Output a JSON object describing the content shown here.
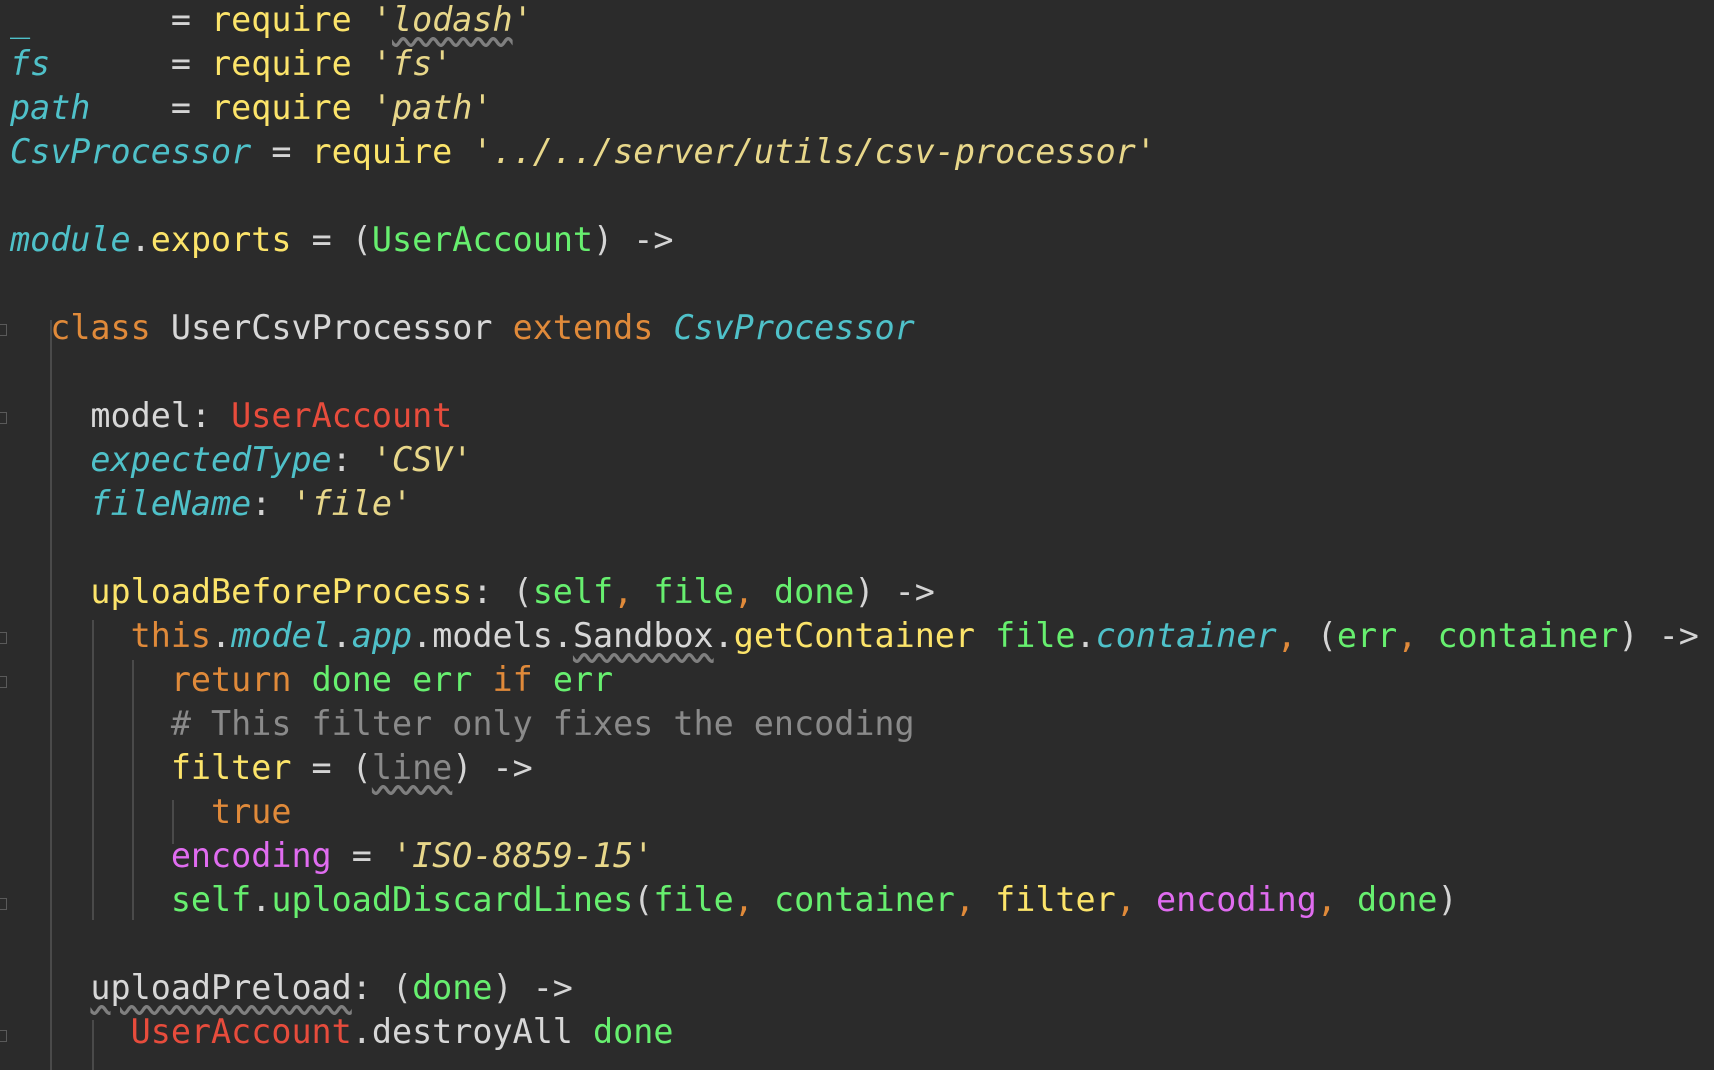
{
  "code_lines": [
    {
      "tokens": [
        [
          "_",
          "id"
        ],
        [
          "       = ",
          "op"
        ],
        [
          "require",
          "fn"
        ],
        [
          " ",
          "op"
        ],
        [
          "'",
          "str"
        ],
        [
          "lodash",
          "str"
        ],
        [
          "'",
          "str"
        ]
      ]
    },
    {
      "tokens": [
        [
          "fs",
          "id"
        ],
        [
          "      = ",
          "op"
        ],
        [
          "require",
          "fn"
        ],
        [
          " ",
          "op"
        ],
        [
          "'fs'",
          "str"
        ]
      ]
    },
    {
      "tokens": [
        [
          "path",
          "id"
        ],
        [
          "    = ",
          "op"
        ],
        [
          "require",
          "fn"
        ],
        [
          " ",
          "op"
        ],
        [
          "'path'",
          "str"
        ]
      ]
    },
    {
      "tokens": [
        [
          "CsvProcessor",
          "id"
        ],
        [
          " = ",
          "op"
        ],
        [
          "require",
          "fn"
        ],
        [
          " ",
          "op"
        ],
        [
          "'../../server/utils/csv-processor'",
          "str"
        ]
      ]
    },
    {
      "tokens": []
    },
    {
      "tokens": [
        [
          "module",
          "id"
        ],
        [
          ".",
          "op"
        ],
        [
          "exports",
          "fn"
        ],
        [
          " = (",
          "op"
        ],
        [
          "UserAccount",
          "param"
        ],
        [
          ") ->",
          "op"
        ]
      ]
    },
    {
      "tokens": []
    },
    {
      "tokens": [
        [
          "  ",
          "op"
        ],
        [
          "class",
          "kw"
        ],
        [
          " ",
          "op"
        ],
        [
          "UserCsvProcessor",
          "prop"
        ],
        [
          " ",
          "op"
        ],
        [
          "extends",
          "kw"
        ],
        [
          " ",
          "op"
        ],
        [
          "CsvProcessor",
          "id"
        ]
      ]
    },
    {
      "tokens": []
    },
    {
      "tokens": [
        [
          "    ",
          "op"
        ],
        [
          "model",
          "prop"
        ],
        [
          ": ",
          "op"
        ],
        [
          "UserAccount",
          "classref"
        ]
      ]
    },
    {
      "tokens": [
        [
          "    ",
          "op"
        ],
        [
          "expectedType",
          "id"
        ],
        [
          ": ",
          "op"
        ],
        [
          "'CSV'",
          "str"
        ]
      ]
    },
    {
      "tokens": [
        [
          "    ",
          "op"
        ],
        [
          "fileName",
          "id"
        ],
        [
          ": ",
          "op"
        ],
        [
          "'file'",
          "str"
        ]
      ]
    },
    {
      "tokens": []
    },
    {
      "tokens": [
        [
          "    ",
          "op"
        ],
        [
          "uploadBeforeProcess",
          "fn"
        ],
        [
          ": (",
          "op"
        ],
        [
          "self",
          "param"
        ],
        [
          ", ",
          "kw"
        ],
        [
          "file",
          "param"
        ],
        [
          ", ",
          "kw"
        ],
        [
          "done",
          "param"
        ],
        [
          ") ->",
          "op"
        ]
      ]
    },
    {
      "tokens": [
        [
          "      ",
          "op"
        ],
        [
          "this",
          "kw"
        ],
        [
          ".",
          "op"
        ],
        [
          "model",
          "id"
        ],
        [
          ".",
          "op"
        ],
        [
          "app",
          "id"
        ],
        [
          ".",
          "op"
        ],
        [
          "models",
          "prop"
        ],
        [
          ".",
          "op"
        ],
        [
          "Sandbox",
          "prop-wavy"
        ],
        [
          ".",
          "op"
        ],
        [
          "getContainer",
          "fn"
        ],
        [
          " ",
          "op"
        ],
        [
          "file",
          "param"
        ],
        [
          ".",
          "op"
        ],
        [
          "container",
          "id"
        ],
        [
          ", ",
          "kw"
        ],
        [
          "(",
          "op"
        ],
        [
          "err",
          "param"
        ],
        [
          ", ",
          "kw"
        ],
        [
          "container",
          "param"
        ],
        [
          ") ->",
          "op"
        ]
      ]
    },
    {
      "tokens": [
        [
          "        ",
          "op"
        ],
        [
          "return",
          "kw"
        ],
        [
          " ",
          "op"
        ],
        [
          "done",
          "param"
        ],
        [
          " ",
          "op"
        ],
        [
          "err",
          "param"
        ],
        [
          " ",
          "op"
        ],
        [
          "if",
          "kw"
        ],
        [
          " ",
          "op"
        ],
        [
          "err",
          "param"
        ]
      ]
    },
    {
      "tokens": [
        [
          "        ",
          "op"
        ],
        [
          "# This filter only fixes the encoding",
          "comment"
        ]
      ]
    },
    {
      "tokens": [
        [
          "        ",
          "op"
        ],
        [
          "filter",
          "fn"
        ],
        [
          " = (",
          "op"
        ],
        [
          "line",
          "comment-wavy"
        ],
        [
          ") ->",
          "op"
        ]
      ]
    },
    {
      "tokens": [
        [
          "          ",
          "op"
        ],
        [
          "true",
          "kw"
        ]
      ]
    },
    {
      "tokens": [
        [
          "        ",
          "op"
        ],
        [
          "encoding",
          "purple"
        ],
        [
          " = ",
          "op"
        ],
        [
          "'ISO-8859-15'",
          "str"
        ]
      ]
    },
    {
      "tokens": [
        [
          "        ",
          "op"
        ],
        [
          "self",
          "param"
        ],
        [
          ".",
          "op"
        ],
        [
          "uploadDiscardLines",
          "param"
        ],
        [
          "(",
          "op"
        ],
        [
          "file",
          "param"
        ],
        [
          ", ",
          "kw"
        ],
        [
          "container",
          "param"
        ],
        [
          ", ",
          "kw"
        ],
        [
          "filter",
          "fn"
        ],
        [
          ", ",
          "kw"
        ],
        [
          "encoding",
          "purple"
        ],
        [
          ", ",
          "kw"
        ],
        [
          "done",
          "param"
        ],
        [
          ")",
          "op"
        ]
      ]
    },
    {
      "tokens": []
    },
    {
      "tokens": [
        [
          "    ",
          "op"
        ],
        [
          "uploadPreload",
          "prop-wavy2"
        ],
        [
          ": (",
          "op"
        ],
        [
          "done",
          "param"
        ],
        [
          ") ->",
          "op"
        ]
      ]
    },
    {
      "tokens": [
        [
          "      ",
          "op"
        ],
        [
          "UserAccount",
          "classref"
        ],
        [
          ".",
          "op"
        ],
        [
          "destroyAll",
          "prop"
        ],
        [
          " ",
          "op"
        ],
        [
          "done",
          "param"
        ]
      ]
    }
  ]
}
